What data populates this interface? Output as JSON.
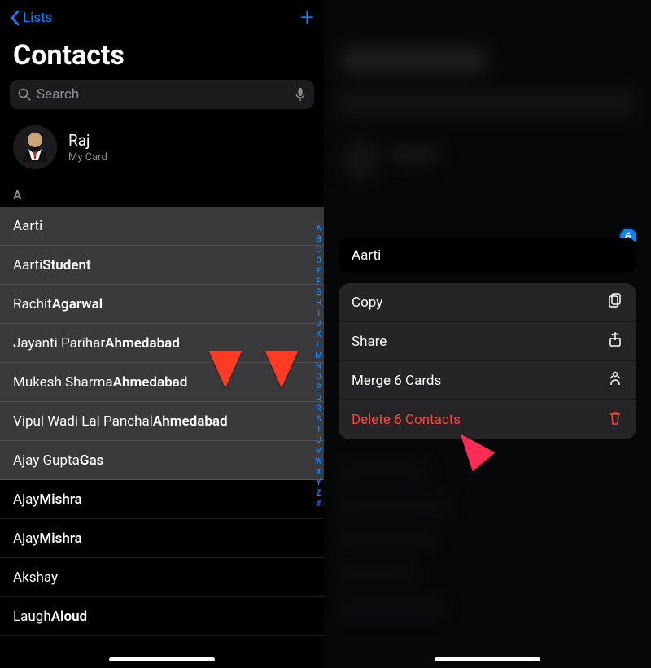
{
  "nav": {
    "back": "Lists"
  },
  "title": "Contacts",
  "search": {
    "placeholder": "Search"
  },
  "mycard": {
    "name": "Raj",
    "sub": "My Card"
  },
  "section": "A",
  "contacts": [
    {
      "first": "Aarti",
      "last": "",
      "sel": true
    },
    {
      "first": "Aarti",
      "last": "Student",
      "sel": true
    },
    {
      "first": "Rachit",
      "last": "Agarwal",
      "sel": true
    },
    {
      "first": "Jayanti Parihar",
      "last": "Ahmedabad",
      "sel": true
    },
    {
      "first": "Mukesh Sharma",
      "last": "Ahmedabad",
      "sel": true
    },
    {
      "first": "Vipul Wadi Lal Panchal",
      "last": "Ahmedabad",
      "sel": true
    },
    {
      "first": "Ajay Gupta",
      "last": "Gas",
      "sel": true
    },
    {
      "first": "Ajay",
      "last": "Mishra",
      "sel": false
    },
    {
      "first": "Ajay",
      "last": "Mishra",
      "sel": false
    },
    {
      "first": "Akshay",
      "last": "",
      "sel": false
    },
    {
      "first": "Laugh",
      "last": "Aloud",
      "sel": false
    }
  ],
  "index": [
    "A",
    "B",
    "C",
    "D",
    "E",
    "F",
    "G",
    "H",
    "I",
    "J",
    "K",
    "L",
    "M",
    "N",
    "O",
    "P",
    "Q",
    "R",
    "S",
    "T",
    "U",
    "V",
    "W",
    "X",
    "Y",
    "Z",
    "#"
  ],
  "popup": {
    "badge": "6",
    "name": "Aarti",
    "items": [
      {
        "label": "Copy",
        "icon": "copy"
      },
      {
        "label": "Share",
        "icon": "share"
      },
      {
        "label": "Merge 6 Cards",
        "icon": "merge"
      },
      {
        "label": "Delete 6 Contacts",
        "icon": "trash",
        "red": true
      }
    ]
  }
}
